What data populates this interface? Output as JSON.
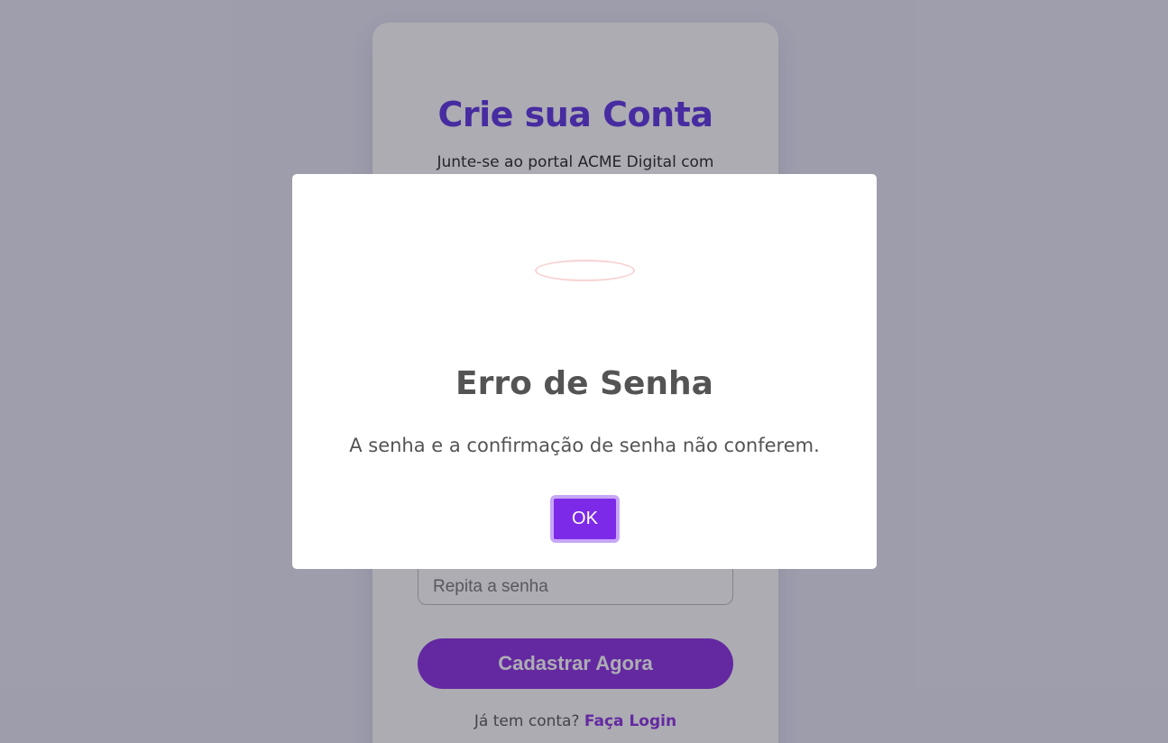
{
  "signup": {
    "title": "Crie sua Conta",
    "subtitle": "Junte-se ao portal ACME Digital com segurança.",
    "confirm_password_placeholder": "Repita a senha",
    "submit_label": "Cadastrar Agora",
    "login_prompt": "Já tem conta?",
    "login_link": "Faça Login"
  },
  "alert": {
    "icon": "error-icon",
    "title": "Erro de Senha",
    "message": "A senha e a confirmação de senha não conferem.",
    "ok_label": "OK"
  },
  "colors": {
    "accent": "#8a2be2",
    "title": "#5b2ee0",
    "ok_button": "#7d2ae8",
    "text_gray": "#545454"
  }
}
